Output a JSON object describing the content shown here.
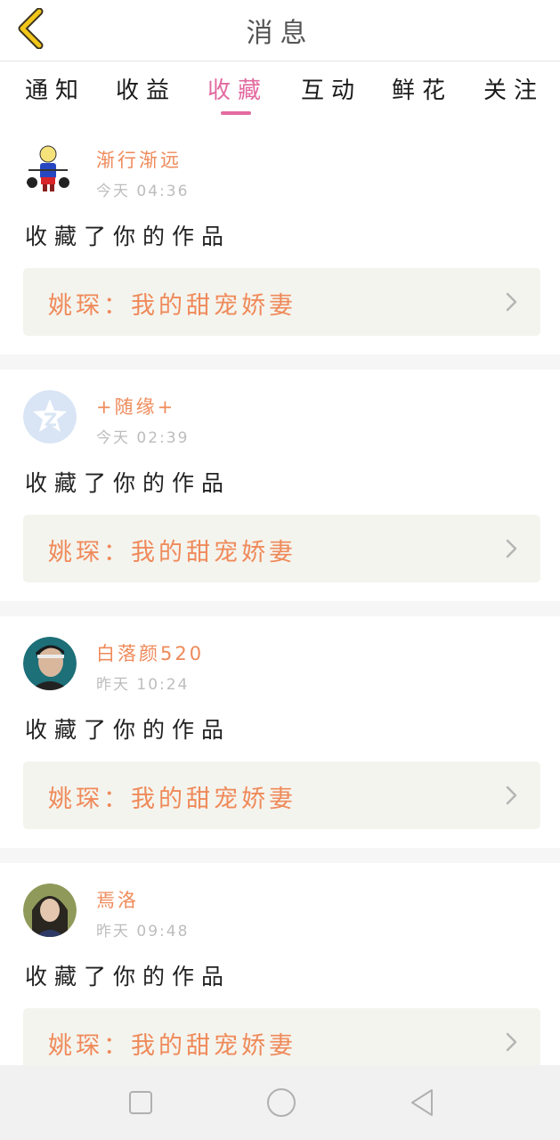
{
  "header": {
    "title": "消息",
    "back_icon": "chevron-left-icon"
  },
  "tabs": [
    {
      "label": "通知",
      "active": false
    },
    {
      "label": "收益",
      "active": false
    },
    {
      "label": "收藏",
      "active": true
    },
    {
      "label": "互动",
      "active": false
    },
    {
      "label": "鲜花",
      "active": false
    },
    {
      "label": "关注",
      "active": false
    }
  ],
  "colors": {
    "accent": "#e26aa0",
    "username": "#ef8a5a",
    "work_box": "#f4f4ee"
  },
  "messages": [
    {
      "username": "渐行渐远",
      "time": "今天 04:36",
      "action": "收藏了你的作品",
      "work": "姚琛：我的甜宠娇妻",
      "avatar": "cartoon-avatar"
    },
    {
      "username": "+随缘+",
      "time": "今天 02:39",
      "action": "收藏了你的作品",
      "work": "姚琛：我的甜宠娇妻",
      "avatar": "default-avatar"
    },
    {
      "username": "白落颜520",
      "time": "昨天 10:24",
      "action": "收藏了你的作品",
      "work": "姚琛：我的甜宠娇妻",
      "avatar": "photo-avatar"
    },
    {
      "username": "焉洛",
      "time": "昨天 09:48",
      "action": "收藏了你的作品",
      "work": "姚琛：我的甜宠娇妻",
      "avatar": "photo-avatar"
    }
  ],
  "navbar": {
    "icons": [
      "recent-apps-icon",
      "home-icon",
      "back-icon"
    ]
  }
}
